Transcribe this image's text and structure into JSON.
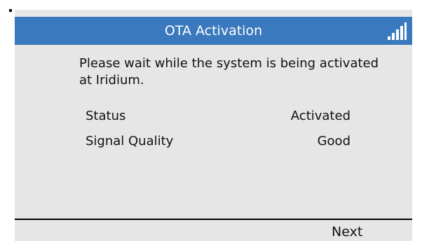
{
  "title_bar": {
    "title": "OTA Activation",
    "signal_icon": "signal-strength-bars"
  },
  "message": "Please wait while the system is being activated at Iridium.",
  "info": [
    {
      "label": "Status",
      "value": "Activated"
    },
    {
      "label": "Signal Quality",
      "value": "Good"
    }
  ],
  "softkeys": {
    "right": "Next"
  },
  "colors": {
    "title_bar_bg": "#3a79bd",
    "screen_bg": "#e6e6e6",
    "text": "#111111"
  }
}
